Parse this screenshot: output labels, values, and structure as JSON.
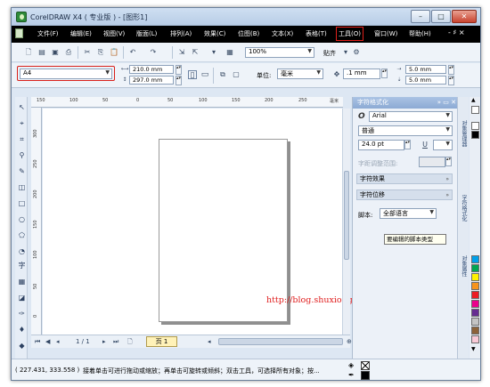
{
  "window": {
    "title": "CorelDRAW X4 ( 专业版 ) - [图形1]",
    "min_glyph": "–",
    "max_glyph": "□",
    "close_glyph": "✕"
  },
  "menubar": {
    "items": [
      "文件(F)",
      "编辑(E)",
      "视图(V)",
      "版面(L)",
      "排列(A)",
      "效果(C)",
      "位图(B)",
      "文本(X)",
      "表格(T)",
      "工具(O)",
      "窗口(W)",
      "帮助(H)"
    ],
    "highlighted": "工具(O)",
    "mdi_controls": "- ♯ ×"
  },
  "standard_toolbar": {
    "zoom": "100%",
    "snap": "贴齐"
  },
  "property_bar": {
    "paper": "A4",
    "width": "210.0 mm",
    "height": "297.0 mm",
    "units_label": "单位:",
    "units_value": "毫米",
    "nudge": ".1 mm",
    "dup_x": "5.0 mm",
    "dup_y": "5.0 mm"
  },
  "rulers": {
    "h_labels": [
      "150",
      "100",
      "50",
      "0",
      "50",
      "100",
      "150",
      "200",
      "250"
    ],
    "v_labels": [
      "300",
      "250",
      "200",
      "150",
      "100",
      "50",
      "0"
    ],
    "unit": "毫米"
  },
  "canvas": {
    "watermark_url": "http://blog.shuxiong.net"
  },
  "page_nav": {
    "counter": "1 / 1",
    "page_tab": "页 1"
  },
  "docker": {
    "title": "字符格式化",
    "font": "Arial",
    "style": "普通",
    "size": "24.0 pt",
    "kerning_label": "字距调整范围:",
    "section_effects": "字符效果",
    "section_shift": "字符位移",
    "script_label": "脚本:",
    "script_value": "全部语言",
    "tooltip": "要编辑的脚本类型"
  },
  "docker_tabs": [
    "对象管理器",
    "字符格式化",
    "对象属性"
  ],
  "palette_colors": [
    "#ffffff",
    "#000000",
    "#00a0e9",
    "#00a651",
    "#fff200",
    "#f7941d",
    "#ed1c24",
    "#ec008c",
    "#662d91",
    "#c4c4c4",
    "#8c6239",
    "#f9c9d6"
  ],
  "status": {
    "coords": "( 227.431, 333.558 )",
    "message": "接着单击可进行拖动或缩放；再单击可旋转或倾斜；双击工具，可选择所有对象；按..."
  }
}
